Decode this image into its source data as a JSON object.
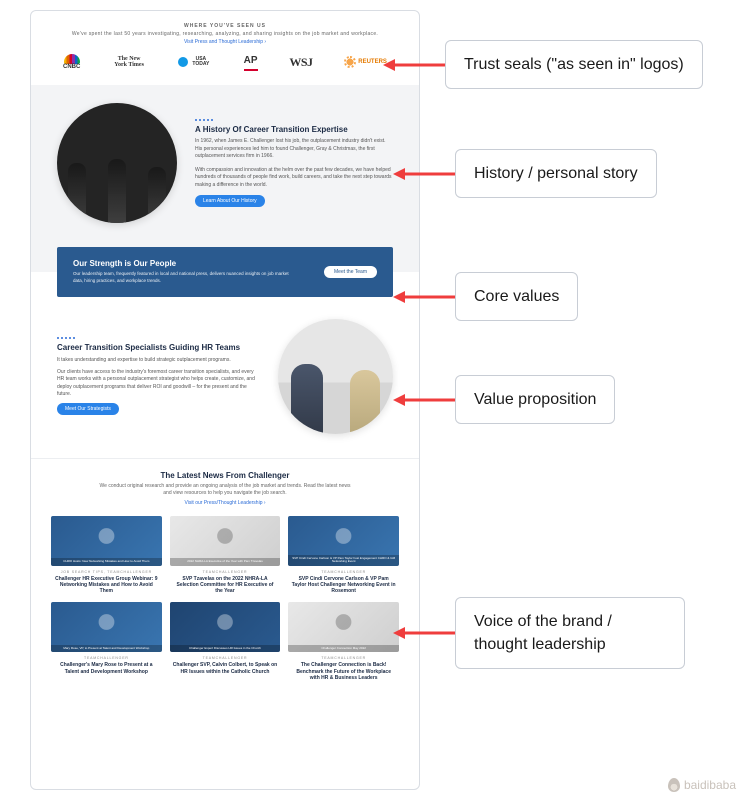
{
  "annotations": [
    {
      "label": "Trust seals (\"as seen in\" logos)"
    },
    {
      "label": "History / personal story"
    },
    {
      "label": "Core values"
    },
    {
      "label": "Value proposition"
    },
    {
      "label": "Voice of the brand / thought leadership"
    }
  ],
  "trust": {
    "eyebrow": "WHERE YOU'VE SEEN US",
    "subtitle": "We've spent the last 50 years investigating, researching, analyzing, and sharing insights on the job market and workplace.",
    "link": "Visit Press and Thought Leadership ›",
    "logos": [
      "CNBC",
      "The New York Times",
      "USA TODAY",
      "AP",
      "WSJ",
      "REUTERS"
    ]
  },
  "history": {
    "title": "A History Of Career Transition Expertise",
    "body1": "In 1962, when James E. Challenger lost his job, the outplacement industry didn't exist. His personal experiences led him to found Challenger, Gray & Christmas, the first outplacement services firm in 1966.",
    "body2": "With compassion and innovation at the helm over the past few decades, we have helped hundreds of thousands of people find work, build careers, and take the next step towards making a difference in the world.",
    "cta": "Learn About Our History"
  },
  "banner": {
    "title": "Our Strength is Our People",
    "body": "Our leadership team, frequently featured in local and national press, delivers nuanced insights on job market data, hiring practices, and workplace trends.",
    "cta": "Meet the Team"
  },
  "value": {
    "title": "Career Transition Specialists Guiding HR Teams",
    "body1": "It takes understanding and expertise to build strategic outplacement programs.",
    "body2": "Our clients have access to the industry's foremost career transition specialists, and every HR team works with a personal outplacement strategist who helps create, customize, and deploy outplacement programs that deliver ROI and goodwill – for the present and the future.",
    "cta": "Meet Our Strategists"
  },
  "news": {
    "heading": "The Latest News From Challenger",
    "subtitle": "We conduct original research and provide an ongoing analysis of the job market and trends. Read the latest news and view resources to help you navigate the job search.",
    "link": "Visit our Press/Thought Leadership ›",
    "eyebrow_default": "TEAMCHALLENGER",
    "cards": [
      {
        "eyebrow": "JOB SEARCH TIPS, TEAMCHALLENGER",
        "thumb_strip": "CHRO Hosts: New Networking Mistakes and How to Avoid Them",
        "title": "Challenger HR Executive Group Webinar: 9 Networking Mistakes and How to Avoid Them",
        "variant": "dark"
      },
      {
        "eyebrow": "TEAMCHALLENGER",
        "thumb_strip": "2022 NHRA-LA Executive of the Year with Pam Tzavelas",
        "title": "SVP Tzavelas on the 2022 NHRA-LA Selection Committee for HR Executive of the Year",
        "variant": "light"
      },
      {
        "eyebrow": "TEAMCHALLENGER",
        "thumb_strip": "SVP Cindi Cervone Carlson & VP Pam Taylor host Engagement CHRO & GM Networking Event",
        "title": "SVP Cindi Cervone Carlson & VP Pam Taylor Host Challenger Networking Event in Rosemont",
        "variant": "dark"
      },
      {
        "eyebrow": "TEAMCHALLENGER",
        "thumb_strip": "Mary Rose, VP, to Present at Talent and Development Workshop",
        "title": "Challenger's Mary Rose to Present at a Talent and Development Workshop",
        "variant": "dark"
      },
      {
        "eyebrow": "TEAMCHALLENGER",
        "thumb_strip": "Challenger Expert Discusses HR Issues in the Church",
        "title": "Challenger SVP, Calvin Colbert, to Speak on HR Issues within the Catholic Church",
        "variant": "alt"
      },
      {
        "eyebrow": "TEAMCHALLENGER",
        "thumb_strip": "Challenger Connection May 2022",
        "title": "The Challenger Connection is Back! Benchmark the Future of the Workplace with HR & Business Leaders",
        "variant": "light"
      }
    ]
  },
  "watermark": "baidibaba",
  "colors": {
    "accent": "#2a83e8",
    "brand_blue": "#2a5a8f",
    "arrow": "#ef3d3d"
  }
}
